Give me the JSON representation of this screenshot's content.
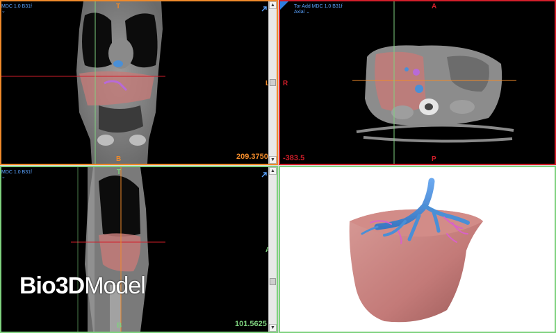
{
  "viewports": {
    "coronal": {
      "header": "MDC 1.0 B31f",
      "orient_top": "T",
      "orient_bottom": "B",
      "orient_right": "L",
      "position_value": "209.3750",
      "border_color": "#f08a2a"
    },
    "axial": {
      "header_line1": "Tor Add MDC 1.0 B31f",
      "header_line2": "Axial",
      "orient_top": "A",
      "orient_bottom": "P",
      "orient_left": "R",
      "position_value": "-383.5",
      "border_color": "#d21e2a"
    },
    "sagittal": {
      "header": "MDC 1.0 B31f",
      "orient_top": "T",
      "orient_bottom": "B",
      "orient_right": "A",
      "position_value": "101.5625",
      "border_color": "#7fd27f"
    },
    "render3d": {
      "icons": [
        "liver-surface-icon",
        "vessel-tree-icon"
      ]
    }
  },
  "dropdown_glyph": "⌄",
  "scroll_up": "▲",
  "scroll_down": "▼",
  "watermark": {
    "bold": "Bio3D",
    "light": "Model"
  },
  "colors": {
    "header_text": "#5aa3ff",
    "orange": "#f08a2a",
    "red": "#d21e2a",
    "green": "#7fd27f",
    "liver": "#c37a78",
    "vessel": "#4a8fd6",
    "vessel_pink": "#d862c8"
  }
}
